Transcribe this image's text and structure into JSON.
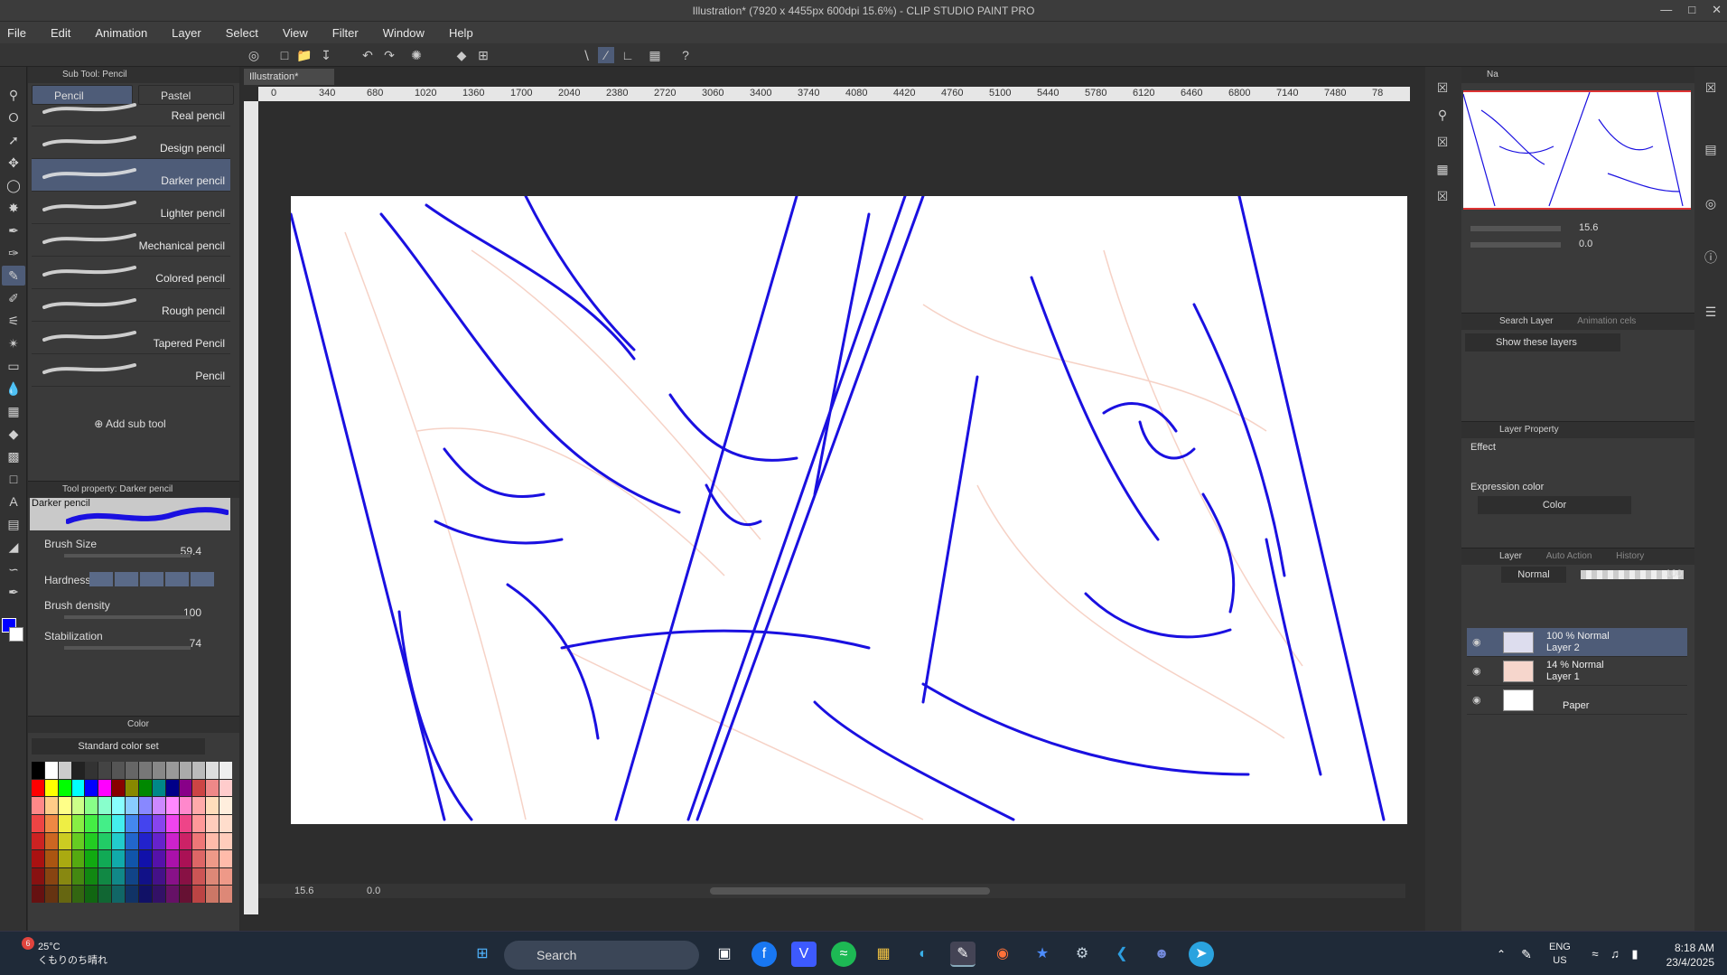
{
  "window": {
    "title": "Illustration* (7920 x 4455px 600dpi 15.6%) - CLIP STUDIO PAINT PRO"
  },
  "menu": [
    "File",
    "Edit",
    "Animation",
    "Layer",
    "Select",
    "View",
    "Filter",
    "Window",
    "Help"
  ],
  "subtool": {
    "header": "Sub Tool: Pencil",
    "tabs": [
      "Pencil",
      "Pastel"
    ],
    "brushes": [
      "Real pencil",
      "Design pencil",
      "Darker pencil",
      "Lighter pencil",
      "Mechanical pencil",
      "Colored pencil",
      "Rough pencil",
      "Tapered Pencil",
      "Pencil"
    ],
    "add_label": "Add sub tool"
  },
  "toolprop": {
    "header": "Tool property: Darker pencil",
    "preview_name": "Darker pencil",
    "rows": [
      {
        "label": "Brush Size",
        "value": "59.4"
      },
      {
        "label": "Hardness",
        "value": ""
      },
      {
        "label": "Brush density",
        "value": "100"
      },
      {
        "label": "Stabilization",
        "value": "74"
      }
    ]
  },
  "colorset": {
    "tab": "Color",
    "set_name": "Standard color set"
  },
  "colors": {
    "main": "#0000ff",
    "sub": "#ffffff",
    "accent": "#4e5c78",
    "stroke": "#1a10e0",
    "sketch": "#f4c7b8"
  },
  "document": {
    "tab": "Illustration*",
    "ruler_ticks": [
      "0",
      "340",
      "680",
      "1020",
      "1360",
      "1700",
      "2040",
      "2380",
      "2720",
      "3060",
      "3400",
      "3740",
      "4080",
      "4420",
      "4760",
      "5100",
      "5440",
      "5780",
      "6120",
      "6460",
      "6800",
      "7140",
      "7480",
      "78"
    ],
    "zoom": "15.6",
    "rotation": "0.0"
  },
  "navigator": {
    "tab": "Na",
    "zoom": "15.6",
    "angle": "0.0"
  },
  "searchlayer": {
    "tab": "Search Layer",
    "tab2": "Animation cels",
    "filter": "Show these layers"
  },
  "layerprop": {
    "tab": "Layer Property",
    "effect": "Effect",
    "expression_label": "Expression color",
    "expression_value": "Color"
  },
  "layerpanel": {
    "tabs": [
      "Layer",
      "Auto Action",
      "History"
    ],
    "blend": "Normal",
    "opacity": "100",
    "layers": [
      {
        "l1": "100 % Normal",
        "l2": "Layer 2"
      },
      {
        "l1": "14 % Normal",
        "l2": "Layer 1"
      },
      {
        "l1": "",
        "l2": "Paper"
      }
    ]
  },
  "taskbar": {
    "temp": "25°C",
    "weather": "くもりのち晴れ",
    "badge": "6",
    "search": "Search",
    "lang1": "ENG",
    "lang2": "US",
    "time": "8:18 AM",
    "date": "23/4/2025"
  }
}
